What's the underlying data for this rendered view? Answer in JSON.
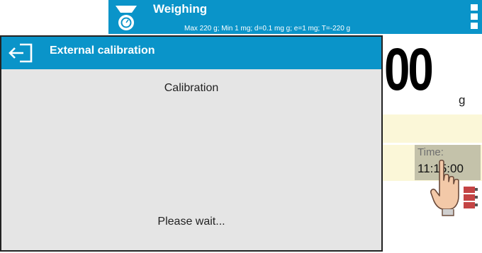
{
  "app": {
    "title": "Weighing",
    "subtitle": "Max 220 g; Min 1 mg; d=0.1 mg g; e=1 mg; T=-220 g",
    "weight_value": "00",
    "weight_unit": "g",
    "time_label": "Time:",
    "time_value": "11:15:00",
    "header_color": "#0a94c9",
    "info_color": "#fbf7d8"
  },
  "dialog": {
    "title": "External calibration",
    "heading": "Calibration",
    "message": "Please wait...",
    "back_icon": "back-arrow-icon"
  }
}
